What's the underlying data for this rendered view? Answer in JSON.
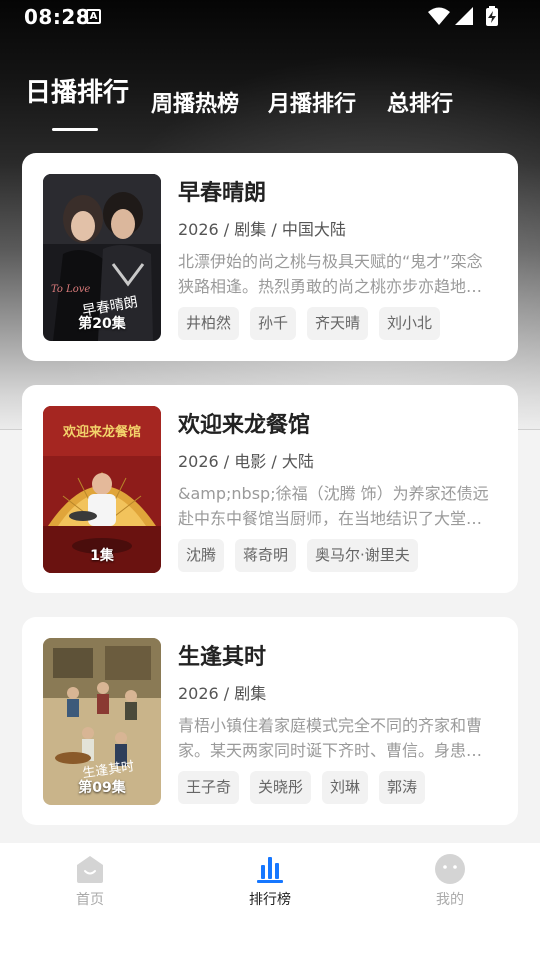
{
  "status": {
    "time": "08:28",
    "notif_glyph": "A",
    "icons": [
      "wifi-icon",
      "signal-icon",
      "battery-charging-icon"
    ]
  },
  "tabs": [
    {
      "label": "日播排行",
      "active": true
    },
    {
      "label": "周播热榜",
      "active": false
    },
    {
      "label": "月播排行",
      "active": false
    },
    {
      "label": "总排行",
      "active": false
    }
  ],
  "items": [
    {
      "title": "早春晴朗",
      "meta": "2026 / 剧集 / 中国大陆",
      "desc": "北漂伊始的尚之桃与极具天赋的“鬼才”栾念狭路相逢。热烈勇敢的尚之桃亦步亦趋地…",
      "episode": "第20集",
      "tags": [
        "井柏然",
        "孙千",
        "齐天晴",
        "刘小北"
      ]
    },
    {
      "title": "欢迎来龙餐馆",
      "meta": "2026 / 电影 / 大陆",
      "desc": "&amp;nbsp;徐福（沈腾 饰）为养家还债远赴中东中餐馆当厨师，在当地结识了大堂…",
      "episode": "1集",
      "tags": [
        "沈腾",
        "蒋奇明",
        "奥马尔·谢里夫"
      ]
    },
    {
      "title": "生逢其时",
      "meta": "2026 / 剧集",
      "desc": "青梧小镇住着家庭模式完全不同的齐家和曹家。某天两家同时诞下齐时、曹信。身患…",
      "episode": "第09集",
      "tags": [
        "王子奇",
        "关晓彤",
        "刘琳",
        "郭涛"
      ]
    }
  ],
  "nav": [
    {
      "label": "首页",
      "icon": "home-icon",
      "active": false
    },
    {
      "label": "排行榜",
      "icon": "ranking-chart-icon",
      "active": true
    },
    {
      "label": "我的",
      "icon": "profile-icon",
      "active": false
    }
  ],
  "colors": {
    "accent": "#1677ff",
    "card_bg": "#ffffff",
    "tag_bg": "#f2f2f2"
  }
}
